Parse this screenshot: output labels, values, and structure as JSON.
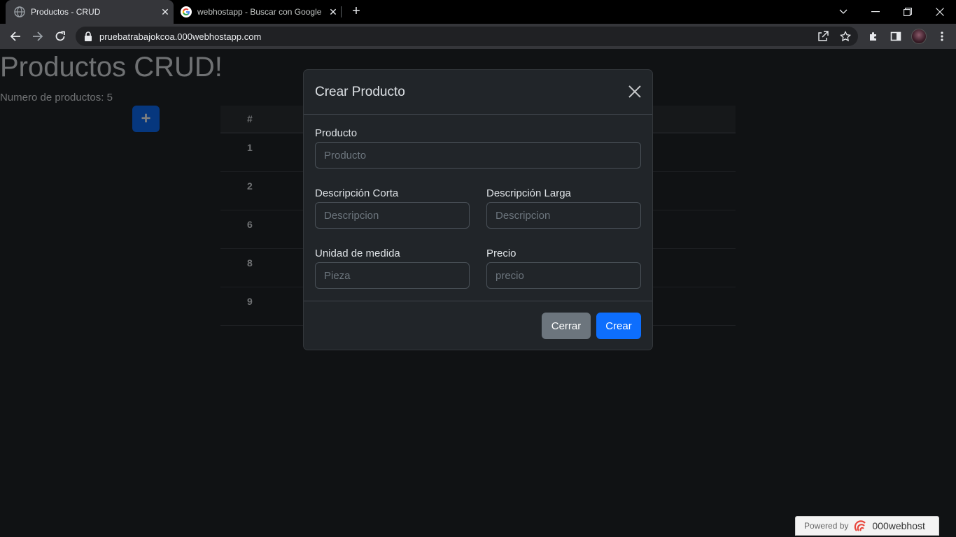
{
  "browser": {
    "tabs": [
      {
        "title": "Productos - CRUD",
        "active": true
      },
      {
        "title": "webhostapp - Buscar con Google",
        "active": false
      }
    ],
    "url": "pruebatrabajokcoa.000webhostapp.com"
  },
  "page": {
    "title": "Productos CRUD!",
    "count_label": "Numero de productos: 5",
    "add_button": "+",
    "table": {
      "header": "#",
      "rows": [
        "1",
        "2",
        "6",
        "8",
        "9"
      ]
    }
  },
  "modal": {
    "title": "Crear Producto",
    "fields": {
      "producto": {
        "label": "Producto",
        "placeholder": "Producto"
      },
      "desc_corta": {
        "label": "Descripción Corta",
        "placeholder": "Descripcion"
      },
      "desc_larga": {
        "label": "Descripción Larga",
        "placeholder": "Descripcion"
      },
      "unidad": {
        "label": "Unidad de medida",
        "placeholder": "Pieza"
      },
      "precio": {
        "label": "Precio",
        "placeholder": "precio"
      }
    },
    "buttons": {
      "close": "Cerrar",
      "create": "Crear"
    }
  },
  "footer": {
    "powered": "Powered by",
    "brand": "000webhost"
  },
  "colors": {
    "primary": "#0d6efd",
    "secondary": "#6c757d",
    "background": "#212529"
  }
}
